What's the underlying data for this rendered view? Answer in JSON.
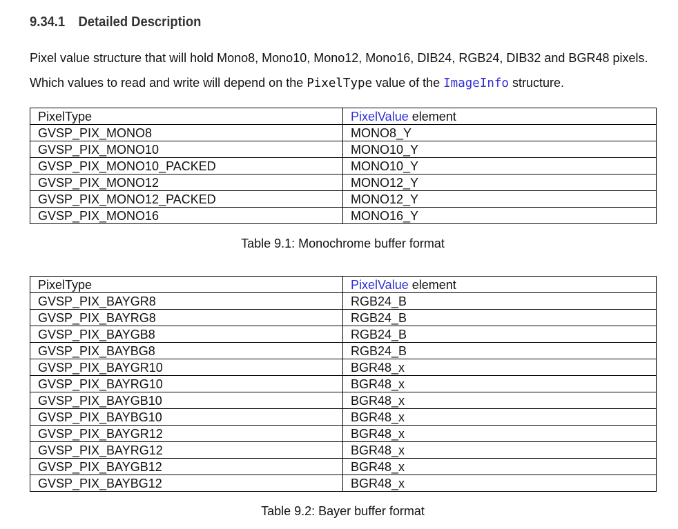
{
  "section": {
    "number": "9.34.1",
    "title": "Detailed Description"
  },
  "intro": {
    "line1": "Pixel value structure that will hold Mono8, Mono10, Mono12, Mono16, DIB24, RGB24, DIB32 and BGR48 pixels.",
    "line2_before": "Which values to read and write will depend on the ",
    "line2_code1": "PixelType",
    "line2_middle": " value of the ",
    "line2_code2": "ImageInfo",
    "line2_after": " structure."
  },
  "table1": {
    "header_col1": "PixelType",
    "header_col2_link": "PixelValue",
    "header_col2_rest": " element",
    "rows": [
      {
        "pixel_type": "GVSP_PIX_MONO8",
        "element": "MONO8_Y"
      },
      {
        "pixel_type": "GVSP_PIX_MONO10",
        "element": "MONO10_Y"
      },
      {
        "pixel_type": "GVSP_PIX_MONO10_PACKED",
        "element": "MONO10_Y"
      },
      {
        "pixel_type": "GVSP_PIX_MONO12",
        "element": "MONO12_Y"
      },
      {
        "pixel_type": "GVSP_PIX_MONO12_PACKED",
        "element": "MONO12_Y"
      },
      {
        "pixel_type": "GVSP_PIX_MONO16",
        "element": "MONO16_Y"
      }
    ],
    "caption": "Table 9.1: Monochrome buffer format"
  },
  "table2": {
    "header_col1": "PixelType",
    "header_col2_link": "PixelValue",
    "header_col2_rest": " element",
    "rows": [
      {
        "pixel_type": "GVSP_PIX_BAYGR8",
        "element": "RGB24_B"
      },
      {
        "pixel_type": "GVSP_PIX_BAYRG8",
        "element": "RGB24_B"
      },
      {
        "pixel_type": "GVSP_PIX_BAYGB8",
        "element": "RGB24_B"
      },
      {
        "pixel_type": "GVSP_PIX_BAYBG8",
        "element": "RGB24_B"
      },
      {
        "pixel_type": "GVSP_PIX_BAYGR10",
        "element": "BGR48_x"
      },
      {
        "pixel_type": "GVSP_PIX_BAYRG10",
        "element": "BGR48_x"
      },
      {
        "pixel_type": "GVSP_PIX_BAYGB10",
        "element": "BGR48_x"
      },
      {
        "pixel_type": "GVSP_PIX_BAYBG10",
        "element": "BGR48_x"
      },
      {
        "pixel_type": "GVSP_PIX_BAYGR12",
        "element": "BGR48_x"
      },
      {
        "pixel_type": "GVSP_PIX_BAYRG12",
        "element": "BGR48_x"
      },
      {
        "pixel_type": "GVSP_PIX_BAYGB12",
        "element": "BGR48_x"
      },
      {
        "pixel_type": "GVSP_PIX_BAYBG12",
        "element": "BGR48_x"
      }
    ],
    "caption": "Table 9.2: Bayer buffer format"
  },
  "colors": {
    "link": "#2e2ed6",
    "heading": "#333333",
    "text": "#111111"
  }
}
